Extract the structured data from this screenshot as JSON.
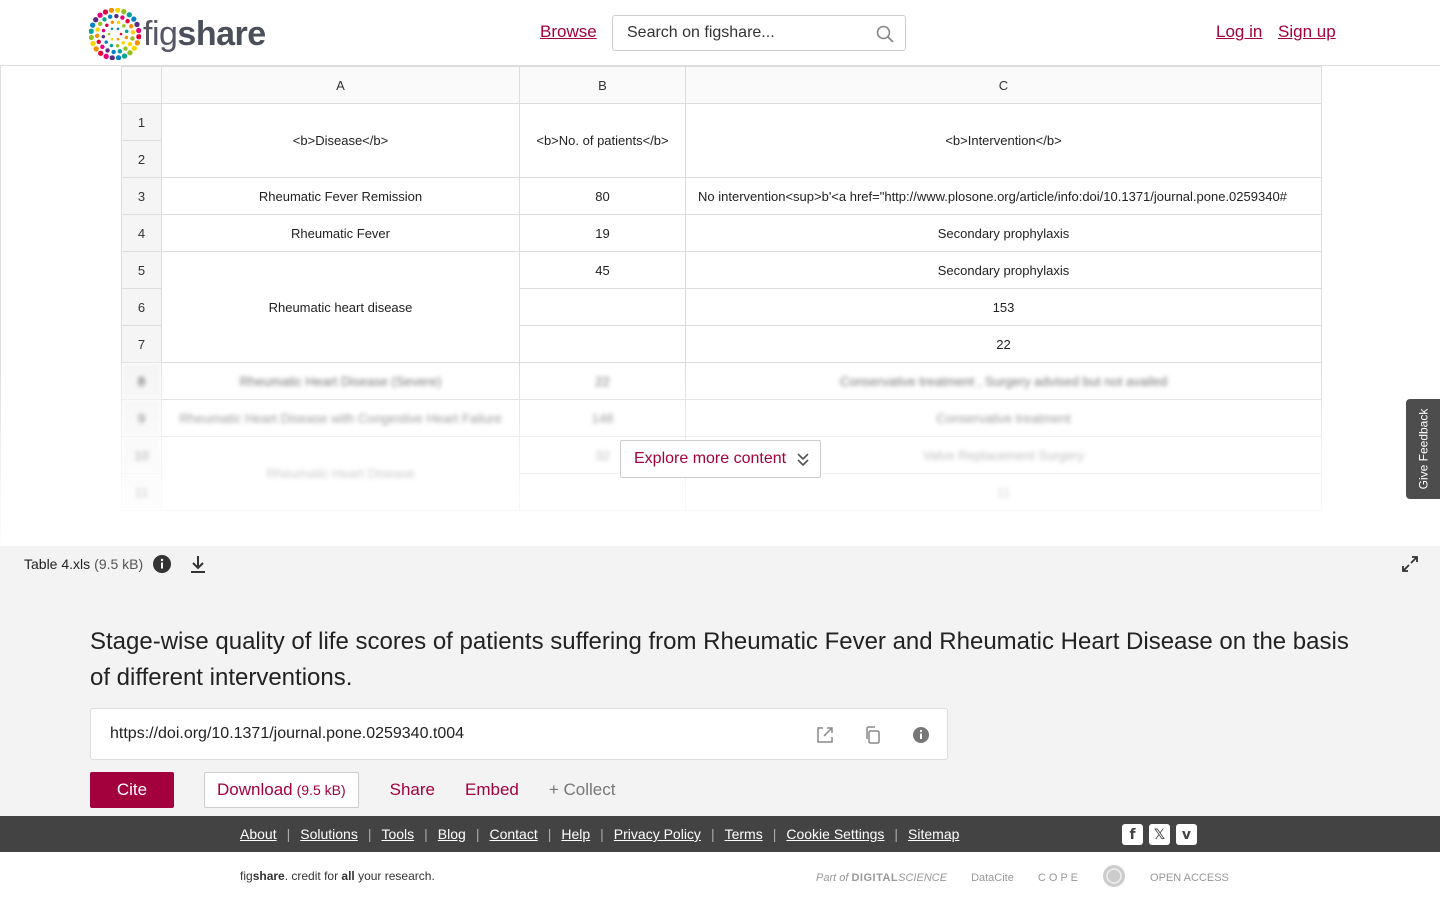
{
  "header": {
    "logo_text_light": "fig",
    "logo_text_bold": "share",
    "browse_label": "Browse",
    "search_placeholder": "Search on figshare...",
    "login_label": "Log in",
    "signup_label": "Sign up"
  },
  "sheet": {
    "columns": [
      "A",
      "B",
      "C"
    ],
    "rows": [
      {
        "num": "1"
      },
      {
        "num": "2"
      },
      {
        "num": "3",
        "a": "Rheumatic Fever Remission",
        "b": "80",
        "c": "No intervention<sup>b'<a href=\"http://www.plosone.org/article/info:doi/10.1371/journal.pone.0259340#"
      },
      {
        "num": "4",
        "a": "Rheumatic Fever",
        "b": "19",
        "c": "Secondary prophylaxis"
      },
      {
        "num": "5",
        "b": "45",
        "c": "Secondary prophylaxis"
      },
      {
        "num": "6",
        "c": "153"
      },
      {
        "num": "7",
        "c": "22"
      },
      {
        "num": "8",
        "a": "Rheumatic Heart Disease (Severe)",
        "b": "22",
        "c": "Conservative treatment , Surgery advised but not availed"
      },
      {
        "num": "9",
        "a": "Rheumatic Heart Disease with Congestive Heart Failure",
        "b": "148",
        "c": "Conservative treatment"
      },
      {
        "num": "10",
        "a": "Rheumatic Heart Disease",
        "b": "32",
        "c": "Valve Replacement Surgery"
      },
      {
        "num": "11",
        "c": "11"
      }
    ],
    "merged_header_a": "<b>Disease</b>",
    "merged_header_b": "<b>No. of patients</b>",
    "merged_header_c": "<b>Intervention</b>",
    "merged_rhd": "Rheumatic heart disease"
  },
  "preview": {
    "explore_label": "Explore more content",
    "file_name": "Table 4.xls",
    "file_size": "(9.5 kB)",
    "feedback_label": "Give Feedback"
  },
  "details": {
    "title": "Stage-wise quality of life scores of patients suffering from Rheumatic Fever and Rheumatic Heart Disease on the basis of different interventions.",
    "doi": "https://doi.org/10.1371/journal.pone.0259340.t004",
    "cite_label": "Cite",
    "download_label": "Download",
    "download_size": "(9.5 kB)",
    "share_label": "Share",
    "embed_label": "Embed",
    "collect_label": "+ Collect"
  },
  "footer": {
    "links": [
      "About",
      "Solutions",
      "Tools",
      "Blog",
      "Contact",
      "Help",
      "Privacy Policy",
      "Terms",
      "Cookie Settings",
      "Sitemap"
    ],
    "credit_fig": "fig",
    "credit_share": "share",
    "credit_mid": ". credit for ",
    "credit_all": "all",
    "credit_end": " your research.",
    "partner_part_of": "Part of",
    "partner_digital": "DIGITAL",
    "partner_science": "SCIENCE",
    "partner_datacite": "DataCite",
    "partner_cope": "C O P E",
    "partner_open": "OPEN ACCESS"
  },
  "colors": {
    "accent": "#a3003e",
    "footer_bar": "#434343",
    "background_gray": "#f3f3f3"
  }
}
